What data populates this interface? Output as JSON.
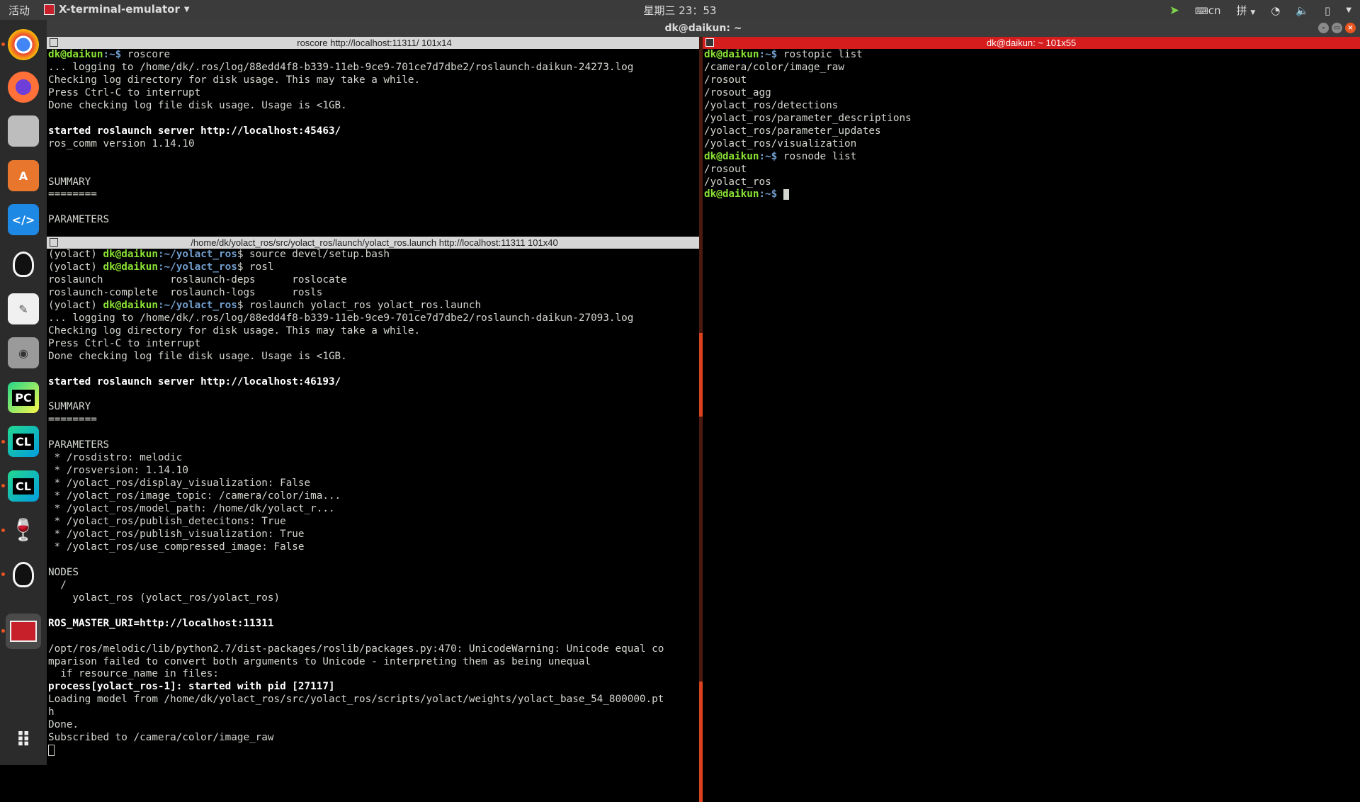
{
  "topbar": {
    "activities": "活动",
    "app_name": "X-terminal-emulator",
    "clock": "星期三 23：53",
    "ime": "cn",
    "keyboard": "拼"
  },
  "window": {
    "title": "dk@daikun: ~"
  },
  "launcher": [
    {
      "name": "chrome",
      "color": "#4285f4"
    },
    {
      "name": "firefox",
      "color": "#ff7139"
    },
    {
      "name": "files",
      "color": "#c8c8c8"
    },
    {
      "name": "software-center",
      "color": "#f08030"
    },
    {
      "name": "vscode",
      "color": "#1e88e5"
    },
    {
      "name": "qq",
      "color": "#222222"
    },
    {
      "name": "text-editor",
      "color": "#e8e8e8"
    },
    {
      "name": "camera",
      "color": "#999999"
    },
    {
      "name": "pycharm",
      "color": "#21d789",
      "label": "PC"
    },
    {
      "name": "clion",
      "color": "#20a0d0",
      "label": "CL"
    },
    {
      "name": "clion-2",
      "color": "#20a0d0",
      "label": "CL"
    },
    {
      "name": "wine",
      "color": "#8b1a1a"
    },
    {
      "name": "qq-2",
      "color": "#222222"
    },
    {
      "name": "terminator",
      "color": "#c8202a"
    }
  ],
  "pane_roscore": {
    "title": "roscore http://localhost:11311/ 101x14",
    "prompt_user": "dk@daikun",
    "prompt_path": ":~$",
    "command": " roscore",
    "lines": [
      "... logging to /home/dk/.ros/log/88edd4f8-b339-11eb-9ce9-701ce7d7dbe2/roslaunch-daikun-24273.log",
      "Checking log directory for disk usage. This may take a while.",
      "Press Ctrl-C to interrupt",
      "Done checking log file disk usage. Usage is <1GB."
    ],
    "bold_server": "started roslaunch server http://localhost:45463/",
    "version": "ros_comm version 1.14.10",
    "summary": "SUMMARY",
    "sep": "========",
    "params": "PARAMETERS"
  },
  "pane_launch": {
    "title": "/home/dk/yolact_ros/src/yolact_ros/launch/yolact_ros.launch http://localhost:11311 101x40",
    "env": "(yolact) ",
    "user": "dk@daikun",
    "path": ":~/yolact_ros",
    "cmd1": "$ source devel/setup.bash",
    "cmd2": "$ rosl",
    "complete1": "roslaunch           roslaunch-deps      roslocate",
    "complete2": "roslaunch-complete  roslaunch-logs      rosls",
    "cmd3": "$ roslaunch yolact_ros yolact_ros.launch",
    "log_lines": [
      "... logging to /home/dk/.ros/log/88edd4f8-b339-11eb-9ce9-701ce7d7dbe2/roslaunch-daikun-27093.log",
      "Checking log directory for disk usage. This may take a while.",
      "Press Ctrl-C to interrupt",
      "Done checking log file disk usage. Usage is <1GB."
    ],
    "bold_server": "started roslaunch server http://localhost:46193/",
    "summary": "SUMMARY",
    "sep": "========",
    "params_header": "PARAMETERS",
    "params": [
      " * /rosdistro: melodic",
      " * /rosversion: 1.14.10",
      " * /yolact_ros/display_visualization: False",
      " * /yolact_ros/image_topic: /camera/color/ima...",
      " * /yolact_ros/model_path: /home/dk/yolact_r...",
      " * /yolact_ros/publish_detecitons: True",
      " * /yolact_ros/publish_visualization: True",
      " * /yolact_ros/use_compressed_image: False"
    ],
    "nodes_header": "NODES",
    "nodes_root": "  /",
    "nodes_item": "    yolact_ros (yolact_ros/yolact_ros)",
    "master_uri": "ROS_MASTER_URI=http://localhost:11311",
    "warn1": "/opt/ros/melodic/lib/python2.7/dist-packages/roslib/packages.py:470: UnicodeWarning: Unicode equal co",
    "warn2": "mparison failed to convert both arguments to Unicode - interpreting them as being unequal",
    "warn3": "  if resource_name in files:",
    "process": "process[yolact_ros-1]: started with pid [27117]",
    "load1": "Loading model from /home/dk/yolact_ros/src/yolact_ros/scripts/yolact/weights/yolact_base_54_800000.pt",
    "load2": "h",
    "done": "Done.",
    "subscribed": "Subscribed to /camera/color/image_raw"
  },
  "pane_right": {
    "title": "dk@daikun: ~ 101x55",
    "user": "dk@daikun",
    "path": ":~$",
    "cmd1": " rostopic list",
    "topics": [
      "/camera/color/image_raw",
      "/rosout",
      "/rosout_agg",
      "/yolact_ros/detections",
      "/yolact_ros/parameter_descriptions",
      "/yolact_ros/parameter_updates",
      "/yolact_ros/visualization"
    ],
    "cmd2": " rosnode list",
    "nodes": [
      "/rosout",
      "/yolact_ros"
    ]
  }
}
